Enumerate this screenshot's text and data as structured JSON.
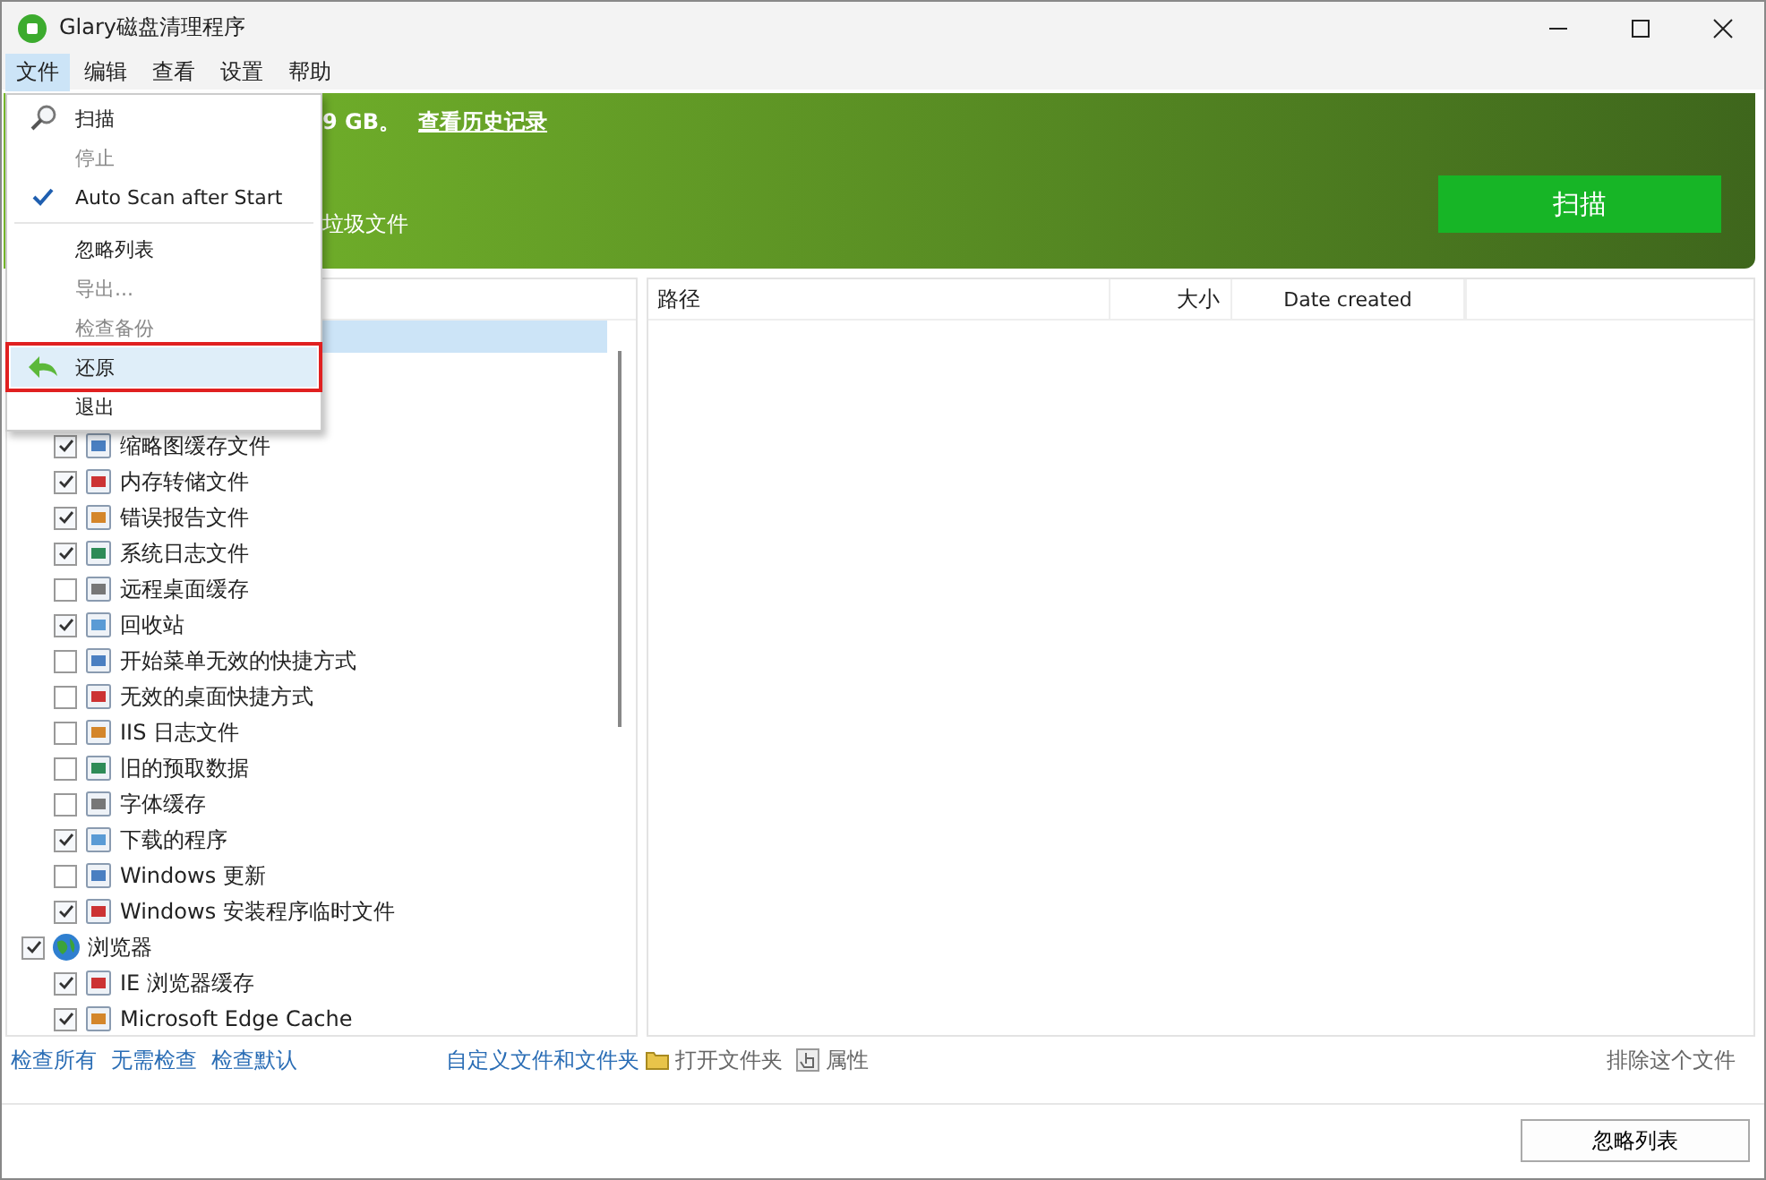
{
  "window": {
    "title": "Glary磁盘清理程序"
  },
  "menubar": [
    {
      "label": "文件",
      "selected": true
    },
    {
      "label": "编辑",
      "selected": false
    },
    {
      "label": "查看",
      "selected": false
    },
    {
      "label": "设置",
      "selected": false
    },
    {
      "label": "帮助",
      "selected": false
    }
  ],
  "file_menu": [
    {
      "kind": "search",
      "label": "扫描",
      "disabled": false,
      "checked": false,
      "selected": false,
      "outlined": false
    },
    {
      "kind": "item",
      "label": "停止",
      "disabled": true,
      "checked": false,
      "selected": false,
      "outlined": false
    },
    {
      "kind": "item",
      "label": "Auto Scan after Start",
      "disabled": false,
      "checked": true,
      "selected": false,
      "outlined": false
    },
    {
      "kind": "separator"
    },
    {
      "kind": "item",
      "label": "忽略列表",
      "disabled": false,
      "checked": false,
      "selected": false,
      "outlined": false
    },
    {
      "kind": "item",
      "label": "导出...",
      "disabled": true,
      "checked": false,
      "selected": false,
      "outlined": false
    },
    {
      "kind": "item",
      "label": "检查备份",
      "disabled": true,
      "checked": false,
      "selected": false,
      "outlined": false
    },
    {
      "kind": "restore",
      "label": "还原",
      "disabled": false,
      "checked": false,
      "selected": true,
      "outlined": true
    },
    {
      "kind": "item",
      "label": "退出",
      "disabled": false,
      "checked": false,
      "selected": false,
      "outlined": false
    }
  ],
  "banner": {
    "summary_tail": "9 GB。",
    "history_link": "查看历史记录",
    "subtitle_tail": "垃圾文件",
    "scan_button": "扫描"
  },
  "tree": [
    {
      "children": [
        {
          "label": "缩略图缓存文件",
          "checked": true
        },
        {
          "label": "内存转储文件",
          "checked": true
        },
        {
          "label": "错误报告文件",
          "checked": true
        },
        {
          "label": "系统日志文件",
          "checked": true
        },
        {
          "label": "远程桌面缓存",
          "checked": false
        },
        {
          "label": "回收站",
          "checked": true
        },
        {
          "label": "开始菜单无效的快捷方式",
          "checked": false
        },
        {
          "label": "无效的桌面快捷方式",
          "checked": false
        },
        {
          "label": "IIS 日志文件",
          "checked": false
        },
        {
          "label": "旧的预取数据",
          "checked": false
        },
        {
          "label": "字体缓存",
          "checked": false
        },
        {
          "label": "下载的程序",
          "checked": true
        },
        {
          "label": "Windows 更新",
          "checked": false
        },
        {
          "label": "Windows 安装程序临时文件",
          "checked": true
        }
      ]
    },
    {
      "label": "浏览器",
      "checked": true,
      "children": [
        {
          "label": "IE 浏览器缓存",
          "checked": true
        },
        {
          "label": "Microsoft Edge Cache",
          "checked": true
        }
      ]
    }
  ],
  "table": {
    "columns": [
      "路径",
      "大小",
      "Date created"
    ]
  },
  "left_links": [
    "检查所有",
    "无需检查",
    "检查默认"
  ],
  "right_links": {
    "custom": "自定义文件和文件夹",
    "open_folder": "打开文件夹",
    "properties": "属性",
    "exclude": "排除这个文件"
  },
  "footer_button": "忽略列表"
}
